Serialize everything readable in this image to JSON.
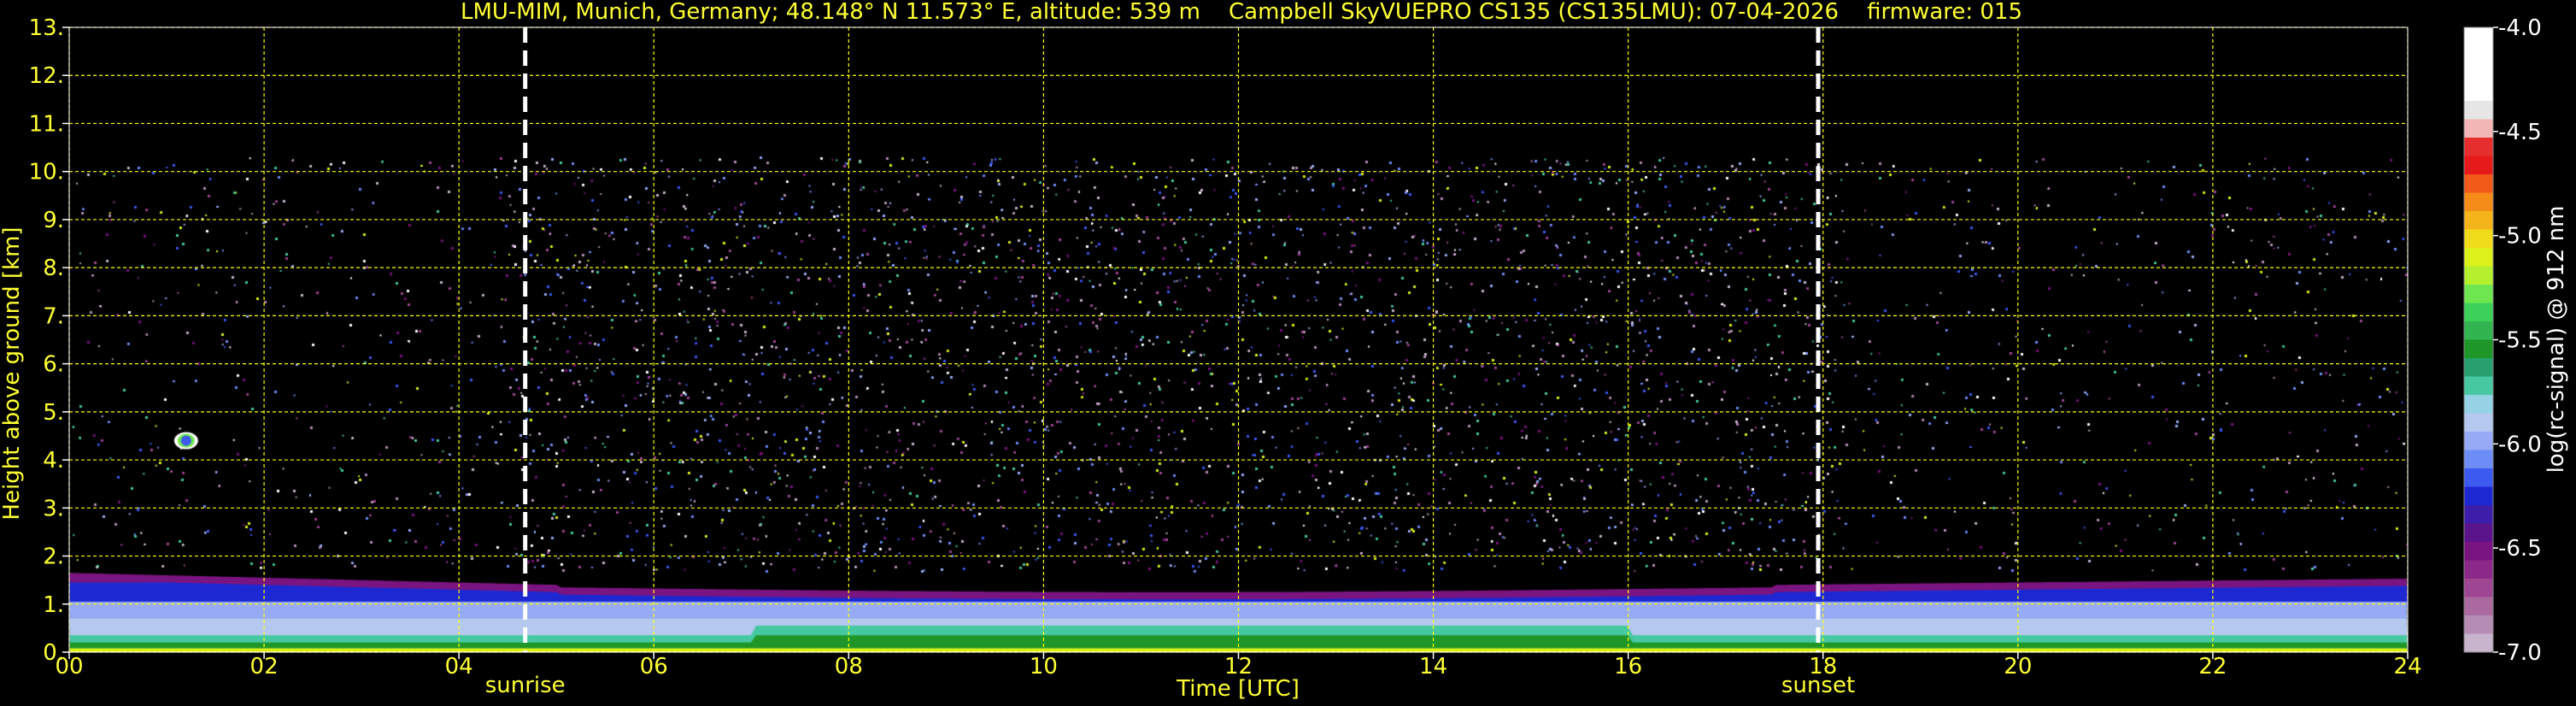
{
  "chart_data": {
    "type": "heatmap",
    "title": "LMU-MIM, Munich, Germany; 48.148° N 11.573° E, altitude: 539 m    Campbell SkyVUEPRO CS135 (CS135LMU): 07-04-2026    firmware: 015",
    "xlabel": "Time [UTC]",
    "ylabel": "Height above ground [km]",
    "xlim": [
      0,
      24
    ],
    "ylim": [
      0,
      13
    ],
    "x_ticks": [
      "00",
      "02",
      "04",
      "06",
      "08",
      "10",
      "12",
      "14",
      "16",
      "18",
      "20",
      "22",
      "24"
    ],
    "y_ticks": [
      "0.",
      "1.",
      "2.",
      "3.",
      "4.",
      "5.",
      "6.",
      "7.",
      "8.",
      "9.",
      "10.",
      "11.",
      "12.",
      "13."
    ],
    "grid": true,
    "grid_color": "#ffff00",
    "data_top_km": 10.3,
    "markers": [
      {
        "label": "sunrise",
        "time": 4.68
      },
      {
        "label": "sunset",
        "time": 17.95
      }
    ],
    "colorbar": {
      "label": "log(rc-signal) @ 912 nm",
      "range": [
        -7.0,
        -4.0
      ],
      "ticks": [
        "-4.0",
        "-4.5",
        "-5.0",
        "-5.5",
        "-6.0",
        "-6.5",
        "-7.0"
      ],
      "colors": [
        "#ffffff",
        "#ffffff",
        "#ffffff",
        "#ffffff",
        "#e6e6e6",
        "#f2b6b6",
        "#e62e2e",
        "#e61a1a",
        "#f25a1a",
        "#f58c1a",
        "#f5b41a",
        "#f0dc1a",
        "#dcf01a",
        "#b4f02e",
        "#6ee650",
        "#3cd25a",
        "#32b450",
        "#1e9628",
        "#28a06e",
        "#46c8a0",
        "#96d2e6",
        "#b4c8f0",
        "#96aaf5",
        "#6e8cf5",
        "#3c5af0",
        "#1e28d2",
        "#3c1eaa",
        "#5a148c",
        "#7a1480",
        "#8c2888",
        "#9e4694",
        "#aa6aa0",
        "#b48cb4",
        "#c8b4cc"
      ]
    },
    "features": [
      {
        "name": "boundary-layer aerosol",
        "x_range": [
          0,
          24
        ],
        "height_km": [
          0.0,
          1.7
        ]
      },
      {
        "name": "isolated cloud",
        "time": 1.2,
        "height_km": 4.4
      },
      {
        "name": "noise background",
        "x_range": [
          0,
          24
        ],
        "height_km": [
          1.7,
          10.3
        ]
      }
    ]
  }
}
